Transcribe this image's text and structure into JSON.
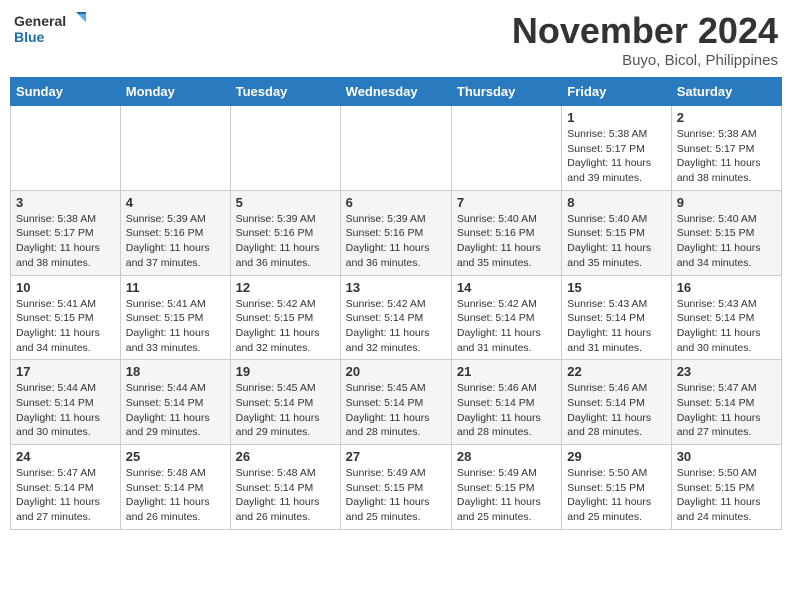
{
  "logo": {
    "line1": "General",
    "line2": "Blue"
  },
  "title": "November 2024",
  "location": "Buyo, Bicol, Philippines",
  "days_header": [
    "Sunday",
    "Monday",
    "Tuesday",
    "Wednesday",
    "Thursday",
    "Friday",
    "Saturday"
  ],
  "weeks": [
    [
      {
        "day": "",
        "info": ""
      },
      {
        "day": "",
        "info": ""
      },
      {
        "day": "",
        "info": ""
      },
      {
        "day": "",
        "info": ""
      },
      {
        "day": "",
        "info": ""
      },
      {
        "day": "1",
        "info": "Sunrise: 5:38 AM\nSunset: 5:17 PM\nDaylight: 11 hours\nand 39 minutes."
      },
      {
        "day": "2",
        "info": "Sunrise: 5:38 AM\nSunset: 5:17 PM\nDaylight: 11 hours\nand 38 minutes."
      }
    ],
    [
      {
        "day": "3",
        "info": "Sunrise: 5:38 AM\nSunset: 5:17 PM\nDaylight: 11 hours\nand 38 minutes."
      },
      {
        "day": "4",
        "info": "Sunrise: 5:39 AM\nSunset: 5:16 PM\nDaylight: 11 hours\nand 37 minutes."
      },
      {
        "day": "5",
        "info": "Sunrise: 5:39 AM\nSunset: 5:16 PM\nDaylight: 11 hours\nand 36 minutes."
      },
      {
        "day": "6",
        "info": "Sunrise: 5:39 AM\nSunset: 5:16 PM\nDaylight: 11 hours\nand 36 minutes."
      },
      {
        "day": "7",
        "info": "Sunrise: 5:40 AM\nSunset: 5:16 PM\nDaylight: 11 hours\nand 35 minutes."
      },
      {
        "day": "8",
        "info": "Sunrise: 5:40 AM\nSunset: 5:15 PM\nDaylight: 11 hours\nand 35 minutes."
      },
      {
        "day": "9",
        "info": "Sunrise: 5:40 AM\nSunset: 5:15 PM\nDaylight: 11 hours\nand 34 minutes."
      }
    ],
    [
      {
        "day": "10",
        "info": "Sunrise: 5:41 AM\nSunset: 5:15 PM\nDaylight: 11 hours\nand 34 minutes."
      },
      {
        "day": "11",
        "info": "Sunrise: 5:41 AM\nSunset: 5:15 PM\nDaylight: 11 hours\nand 33 minutes."
      },
      {
        "day": "12",
        "info": "Sunrise: 5:42 AM\nSunset: 5:15 PM\nDaylight: 11 hours\nand 32 minutes."
      },
      {
        "day": "13",
        "info": "Sunrise: 5:42 AM\nSunset: 5:14 PM\nDaylight: 11 hours\nand 32 minutes."
      },
      {
        "day": "14",
        "info": "Sunrise: 5:42 AM\nSunset: 5:14 PM\nDaylight: 11 hours\nand 31 minutes."
      },
      {
        "day": "15",
        "info": "Sunrise: 5:43 AM\nSunset: 5:14 PM\nDaylight: 11 hours\nand 31 minutes."
      },
      {
        "day": "16",
        "info": "Sunrise: 5:43 AM\nSunset: 5:14 PM\nDaylight: 11 hours\nand 30 minutes."
      }
    ],
    [
      {
        "day": "17",
        "info": "Sunrise: 5:44 AM\nSunset: 5:14 PM\nDaylight: 11 hours\nand 30 minutes."
      },
      {
        "day": "18",
        "info": "Sunrise: 5:44 AM\nSunset: 5:14 PM\nDaylight: 11 hours\nand 29 minutes."
      },
      {
        "day": "19",
        "info": "Sunrise: 5:45 AM\nSunset: 5:14 PM\nDaylight: 11 hours\nand 29 minutes."
      },
      {
        "day": "20",
        "info": "Sunrise: 5:45 AM\nSunset: 5:14 PM\nDaylight: 11 hours\nand 28 minutes."
      },
      {
        "day": "21",
        "info": "Sunrise: 5:46 AM\nSunset: 5:14 PM\nDaylight: 11 hours\nand 28 minutes."
      },
      {
        "day": "22",
        "info": "Sunrise: 5:46 AM\nSunset: 5:14 PM\nDaylight: 11 hours\nand 28 minutes."
      },
      {
        "day": "23",
        "info": "Sunrise: 5:47 AM\nSunset: 5:14 PM\nDaylight: 11 hours\nand 27 minutes."
      }
    ],
    [
      {
        "day": "24",
        "info": "Sunrise: 5:47 AM\nSunset: 5:14 PM\nDaylight: 11 hours\nand 27 minutes."
      },
      {
        "day": "25",
        "info": "Sunrise: 5:48 AM\nSunset: 5:14 PM\nDaylight: 11 hours\nand 26 minutes."
      },
      {
        "day": "26",
        "info": "Sunrise: 5:48 AM\nSunset: 5:14 PM\nDaylight: 11 hours\nand 26 minutes."
      },
      {
        "day": "27",
        "info": "Sunrise: 5:49 AM\nSunset: 5:15 PM\nDaylight: 11 hours\nand 25 minutes."
      },
      {
        "day": "28",
        "info": "Sunrise: 5:49 AM\nSunset: 5:15 PM\nDaylight: 11 hours\nand 25 minutes."
      },
      {
        "day": "29",
        "info": "Sunrise: 5:50 AM\nSunset: 5:15 PM\nDaylight: 11 hours\nand 25 minutes."
      },
      {
        "day": "30",
        "info": "Sunrise: 5:50 AM\nSunset: 5:15 PM\nDaylight: 11 hours\nand 24 minutes."
      }
    ]
  ]
}
